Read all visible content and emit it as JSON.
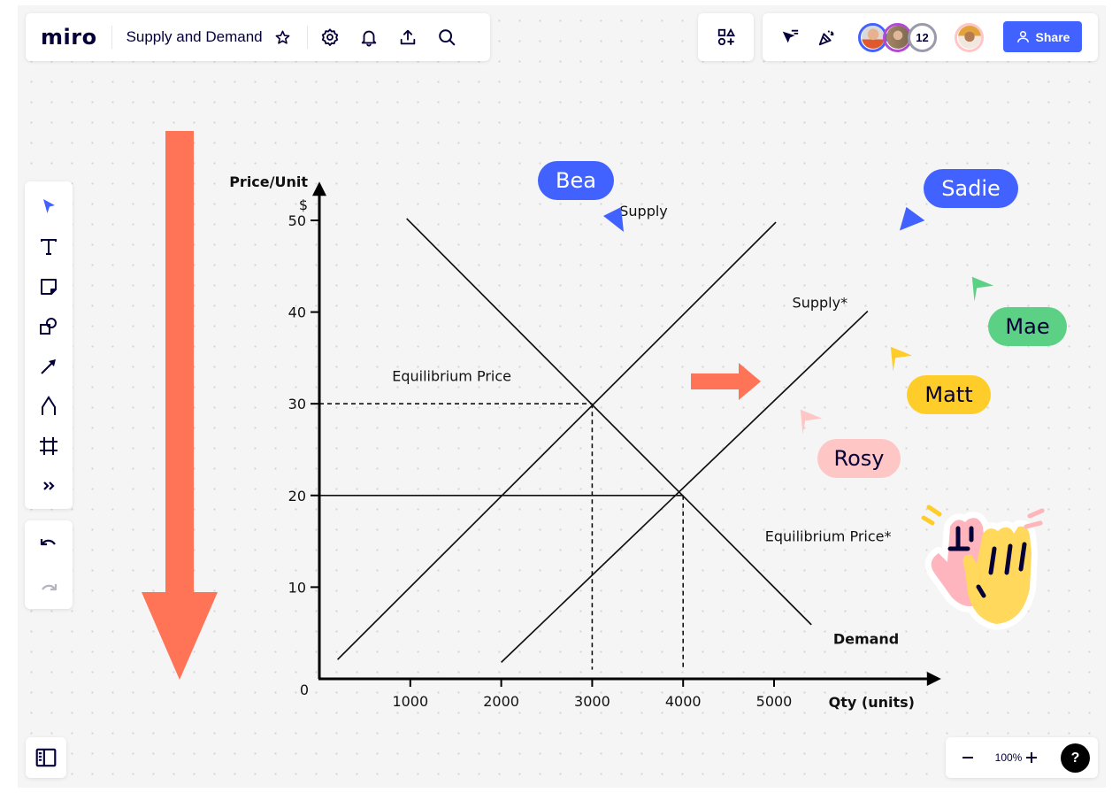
{
  "app": {
    "logo": "miro",
    "board_title": "Supply and Demand"
  },
  "topbar": {
    "icons": [
      "star-icon",
      "settings-icon",
      "bell-icon",
      "upload-icon",
      "search-icon"
    ],
    "apps_icon": "shapes-plus-icon",
    "cursor_icon": "cursor-filter-icon",
    "celebrate_icon": "party-popper-icon",
    "avatar_extra_count": "12",
    "share_label": "Share"
  },
  "colors": {
    "accent": "#4262ff",
    "text_dark": "#050038",
    "orange_arrow": "#ff7356",
    "cursor_bea": "#4262ff",
    "cursor_sadie": "#4262ff",
    "cursor_mae": "#5cd186",
    "cursor_matt": "#ffcd2a",
    "cursor_rosy": "#ffc6c6"
  },
  "toolbar": {
    "tools": [
      {
        "name": "select-tool",
        "icon": "pointer-icon",
        "active": true
      },
      {
        "name": "text-tool",
        "icon": "text-icon"
      },
      {
        "name": "sticky-note-tool",
        "icon": "sticky-note-icon"
      },
      {
        "name": "shapes-tool",
        "icon": "shapes-icon"
      },
      {
        "name": "connector-tool",
        "icon": "arrow-line-icon"
      },
      {
        "name": "pen-tool",
        "icon": "pen-icon"
      },
      {
        "name": "frame-tool",
        "icon": "frame-icon"
      },
      {
        "name": "more-tools",
        "icon": "double-chevron-right-icon"
      }
    ],
    "undo_icon": "undo-icon",
    "redo_icon": "redo-icon"
  },
  "bottom": {
    "zoom_level": "100%",
    "help_label": "?"
  },
  "collaborators": [
    {
      "name": "Bea",
      "color": "#4262ff",
      "text_color": "#ffffff"
    },
    {
      "name": "Sadie",
      "color": "#4262ff",
      "text_color": "#ffffff"
    },
    {
      "name": "Mae",
      "color": "#5cd186",
      "text_color": "#050038"
    },
    {
      "name": "Matt",
      "color": "#ffcd2a",
      "text_color": "#050038"
    },
    {
      "name": "Rosy",
      "color": "#ffc6c6",
      "text_color": "#050038"
    }
  ],
  "chart_data": {
    "type": "line",
    "title": "",
    "xlabel": "Qty (units)",
    "ylabel": "Price/Unit",
    "ylabel_unit": "$",
    "origin_label": "0",
    "xlim": [
      0,
      6000
    ],
    "ylim": [
      0,
      55
    ],
    "x_ticks": [
      1000,
      2000,
      3000,
      4000,
      5000
    ],
    "x_tick_labels": [
      "1000",
      "2000",
      "3000",
      "4000",
      "5000"
    ],
    "y_ticks": [
      10,
      20,
      30,
      40,
      50
    ],
    "y_tick_labels": [
      "10",
      "20",
      "30",
      "40",
      "50"
    ],
    "grid": false,
    "series": [
      {
        "name": "Demand",
        "points": [
          [
            960,
            50.2
          ],
          [
            5410,
            5.9
          ]
        ],
        "style": "solid"
      },
      {
        "name": "Supply",
        "points": [
          [
            200,
            2.1
          ],
          [
            5020,
            49.8
          ]
        ],
        "style": "solid"
      },
      {
        "name": "Supply*",
        "points": [
          [
            2000,
            1.8
          ],
          [
            6030,
            40.1
          ]
        ],
        "style": "solid"
      }
    ],
    "reference_lines": [
      {
        "name": "equilibrium-price-line",
        "points": [
          [
            0,
            30
          ],
          [
            3000,
            30
          ]
        ],
        "style": "dashed"
      },
      {
        "name": "equilibrium-qty-line",
        "points": [
          [
            3000,
            30
          ],
          [
            3000,
            1
          ]
        ],
        "style": "dashed"
      },
      {
        "name": "equilibrium-price-star-line",
        "points": [
          [
            0,
            20
          ],
          [
            4000,
            20
          ]
        ],
        "style": "solid"
      },
      {
        "name": "equilibrium-qty-star-line",
        "points": [
          [
            4000,
            20
          ],
          [
            4000,
            1
          ]
        ],
        "style": "dashed"
      }
    ],
    "annotations": [
      {
        "text": "Supply",
        "at": [
          3300,
          50.5
        ]
      },
      {
        "text": "Supply*",
        "at": [
          5200,
          40.5
        ]
      },
      {
        "text": "Equilibrium Price",
        "at": [
          800,
          32.5
        ]
      },
      {
        "text": "Equilibrium Price*",
        "at": [
          4900,
          15
        ]
      },
      {
        "text": "Demand",
        "at": [
          5650,
          3.8
        ],
        "bold": true
      }
    ],
    "equilibria": [
      {
        "label": "Equilibrium Price",
        "qty": 3000,
        "price": 30
      },
      {
        "label": "Equilibrium Price*",
        "qty": 4000,
        "price": 20
      }
    ]
  }
}
